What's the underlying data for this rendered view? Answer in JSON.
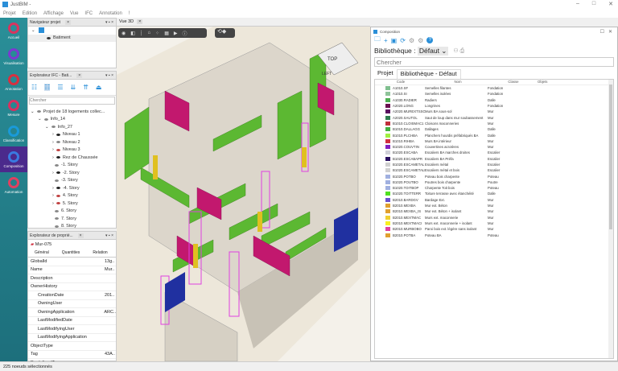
{
  "app": {
    "title": "JustBIM -"
  },
  "menu": [
    "Projet",
    "Edition",
    "Affichage",
    "Vue",
    "IFC",
    "Annotation",
    "!"
  ],
  "sidebar": [
    {
      "label": "Accueil",
      "icon": "home-icon"
    },
    {
      "label": "Visualisation",
      "icon": "visualisation-icon"
    },
    {
      "label": "Annotation",
      "icon": "annotation-icon"
    },
    {
      "label": "Mesure",
      "icon": "measure-icon"
    },
    {
      "label": "Classification",
      "icon": "classification-icon"
    },
    {
      "label": "Composition",
      "icon": "composition-icon",
      "active": true
    },
    {
      "label": "Automation",
      "icon": "automation-icon"
    }
  ],
  "navigator": {
    "title": "Navigateur projet",
    "items": [
      "Batiment"
    ]
  },
  "ifc_explorer": {
    "title": "Explorateur IFC - Bati...",
    "search_placeholder": "Chercher",
    "tree": [
      {
        "label": "Projet de 18 logements collec...",
        "level": 0
      },
      {
        "label": "Info_14",
        "level": 1
      },
      {
        "label": "Info_27",
        "level": 2
      },
      {
        "label": "Niveau 1",
        "level": 3
      },
      {
        "label": "Niveau 2",
        "level": 3
      },
      {
        "label": "Niveau 3",
        "level": 3
      },
      {
        "label": "Rez de Chaussée",
        "level": 3
      },
      {
        "label": "-1. Story",
        "level": 3
      },
      {
        "label": "-2. Story",
        "level": 3
      },
      {
        "label": "-3. Story",
        "level": 3
      },
      {
        "label": "-4. Story",
        "level": 3
      },
      {
        "label": "4. Story",
        "level": 3
      },
      {
        "label": "5. Story",
        "level": 3
      },
      {
        "label": "6. Story",
        "level": 3
      },
      {
        "label": "7. Story",
        "level": 3
      },
      {
        "label": "8. Story",
        "level": 3
      }
    ]
  },
  "properties": {
    "title": "Explorateur de proprié...",
    "object": "Mur-075",
    "tabs": [
      "Général",
      "Quantities",
      "Relation"
    ],
    "rows": [
      {
        "k": "GlobalId",
        "v": "13g.."
      },
      {
        "k": "Name",
        "v": "Mur.."
      },
      {
        "k": "Description",
        "v": ""
      },
      {
        "k": "OwnerHistory",
        "v": ""
      },
      {
        "k": "CreationDate",
        "v": "201..",
        "indent": true
      },
      {
        "k": "OwningUser",
        "v": "",
        "indent": true
      },
      {
        "k": "OwningApplication",
        "v": "ARC..",
        "indent": true
      },
      {
        "k": "LastModifiedDate",
        "v": "",
        "indent": true
      },
      {
        "k": "LastModifyingUser",
        "v": "",
        "indent": true
      },
      {
        "k": "LastModifyingApplication",
        "v": "",
        "indent": true
      },
      {
        "k": "ObjectType",
        "v": ""
      },
      {
        "k": "Tag",
        "v": "43A.."
      },
      {
        "k": "PredefinedType",
        "v": ""
      }
    ]
  },
  "view3d": {
    "tab": "Vue 3D",
    "cube_labels": [
      "TOP",
      "LEFT"
    ]
  },
  "composition": {
    "title": "Composition",
    "library_label": "Bibliothèque :",
    "library_value": "Défaut",
    "search_placeholder": "Chercher",
    "tabs": [
      "Projet",
      "Bibliothèque - Défaut"
    ],
    "columns": [
      "Code",
      "Nom",
      "Classe",
      "Objets"
    ],
    "rows": [
      {
        "code": "A1010.SF",
        "nom": "Semelles filantes",
        "classe": "Fondation",
        "color": "#7fbf8f"
      },
      {
        "code": "A1010.SI",
        "nom": "Semelles isolées",
        "classe": "Fondation",
        "color": "#8fc49a"
      },
      {
        "code": "A1030.RADIER",
        "nom": "Radiers",
        "classe": "Dalle",
        "color": "#4caf50"
      },
      {
        "code": "A2020.LONG",
        "nom": "Longrines",
        "classe": "Fondation",
        "color": "#6a1050"
      },
      {
        "code": "A2020.MUREXTSSOL",
        "nom": "Murs BA sous-sol",
        "classe": "Mur",
        "color": "#5a1060"
      },
      {
        "code": "A2020.SAUTOL",
        "nom": "Saut de loup dans mur soubassement",
        "classe": "Mur",
        "color": "#2e7d4f"
      },
      {
        "code": "B1010.CLOISMAC1",
        "nom": "Cloisons maconneries",
        "classe": "Mur",
        "color": "#c0303c"
      },
      {
        "code": "B1010.DALLAGG",
        "nom": "Dallages",
        "classe": "Dalle",
        "color": "#40b040"
      },
      {
        "code": "B1010.PLCHBA",
        "nom": "Planchers hourdis préfabriqués BA",
        "classe": "Dalle",
        "color": "#a0f040"
      },
      {
        "code": "B1010.RIHBA",
        "nom": "Murs BA intérieur",
        "classe": "Mur",
        "color": "#d03040"
      },
      {
        "code": "B1020.COUVTIN",
        "nom": "Couvertines acrotères",
        "classe": "Mur",
        "color": "#8020c0"
      },
      {
        "code": "B1020.ESCABA",
        "nom": "Escaliers BA marches droites",
        "classe": "Escalier",
        "color": "#d0d0d8"
      },
      {
        "code": "B1020.ESCABAPR",
        "nom": "Escaliers BA Préfa",
        "classe": "Escalier",
        "color": "#2a1060"
      },
      {
        "code": "B1020.ESCAMETAL",
        "nom": "Escaliers métal",
        "classe": "Escalier",
        "color": "#d0d0d0"
      },
      {
        "code": "B1020.ESCAMETALB",
        "nom": "Escaliers métal et bois",
        "classe": "Escalier",
        "color": "#d0d0d0"
      },
      {
        "code": "B1020.POTBO",
        "nom": "Poteau bois charpente",
        "classe": "Poteau",
        "color": "#a0b0e0"
      },
      {
        "code": "B1020.POUTBO",
        "nom": "Poutres bois charpente",
        "classe": "Poutre",
        "color": "#a0b0e0"
      },
      {
        "code": "B1020.TOITBOP",
        "nom": "Charpente Toit bois",
        "classe": "Poteau",
        "color": "#a0b0e0"
      },
      {
        "code": "B1020.TOITTERR",
        "nom": "Toiture terrasse avec étanchéité",
        "classe": "Dalle",
        "color": "#50e020"
      },
      {
        "code": "B2010.BARDGV",
        "nom": "Bardage Ext.",
        "classe": "Mur",
        "color": "#6a50d0"
      },
      {
        "code": "B2010.MEXBA",
        "nom": "Mur ext. Béton",
        "classe": "Mur",
        "color": "#e0a030"
      },
      {
        "code": "B2010.MEXBA_IS",
        "nom": "Mur ext. Béton + isolant",
        "classe": "Mur",
        "color": "#e0a030"
      },
      {
        "code": "B2010.MEXTMAC",
        "nom": "Murs ext. maconnerie",
        "classe": "Mur",
        "color": "#f0d030"
      },
      {
        "code": "B2010.MEXTMACI",
        "nom": "Murs ext. maconnerie + isolant",
        "classe": "Mur",
        "color": "#f8f020"
      },
      {
        "code": "B2010.MURBOBO",
        "nom": "Paroi bois ext. légère sans isolant",
        "classe": "Mur",
        "color": "#e040a0"
      },
      {
        "code": "B2010.POTBA",
        "nom": "Poteau BA",
        "classe": "Poteau",
        "color": "#e0a030"
      }
    ]
  },
  "status": "225 noeuds sélectionnés"
}
